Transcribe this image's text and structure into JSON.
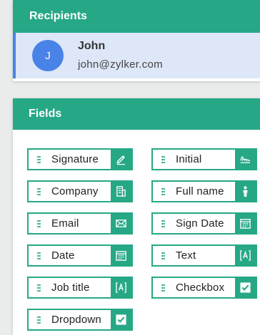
{
  "recipients": {
    "title": "Recipients",
    "items": [
      {
        "initial": "J",
        "name": "John",
        "email": "john@zylker.com",
        "accent": "#4a83e8"
      }
    ]
  },
  "fields": {
    "title": "Fields",
    "accent": "#26a886",
    "items": [
      {
        "label": "Signature",
        "icon": "signature-pen-icon"
      },
      {
        "label": "Initial",
        "icon": "initial-scribble-icon"
      },
      {
        "label": "Company",
        "icon": "building-icon"
      },
      {
        "label": "Full name",
        "icon": "person-icon"
      },
      {
        "label": "Email",
        "icon": "envelope-icon"
      },
      {
        "label": "Sign Date",
        "icon": "calendar-icon"
      },
      {
        "label": "Date",
        "icon": "calendar-icon"
      },
      {
        "label": "Text",
        "icon": "text-box-icon"
      },
      {
        "label": "Job title",
        "icon": "text-box-icon"
      },
      {
        "label": "Checkbox",
        "icon": "checkbox-icon"
      },
      {
        "label": "Dropdown",
        "icon": "checkbox-icon"
      }
    ]
  }
}
